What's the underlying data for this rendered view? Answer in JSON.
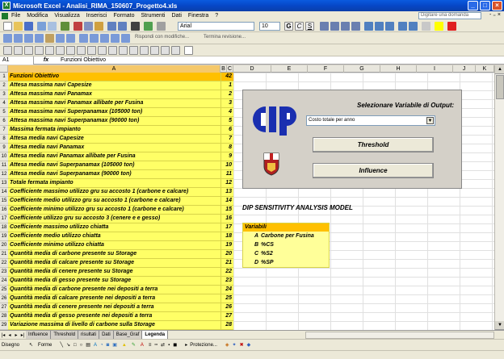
{
  "window": {
    "title": "Microsoft Excel - Analisi_RIMA_150607_Progetto4.xls"
  },
  "menu": {
    "items": [
      "File",
      "Modifica",
      "Visualizza",
      "Inserisci",
      "Formato",
      "Strumenti",
      "Dati",
      "Finestra",
      "?"
    ],
    "help_placeholder": "Digitare una domanda"
  },
  "toolbar": {
    "font_name": "Arial",
    "font_size": "10",
    "reply_text": "Rispondi con modifiche...",
    "end_review": "Termina revisione..."
  },
  "formula_bar": {
    "cell_ref": "A1",
    "fx": "fx",
    "content": "Funzioni Obiettivo"
  },
  "columns": [
    "A",
    "B",
    "C",
    "D",
    "E",
    "F",
    "G",
    "H",
    "I",
    "J",
    "K"
  ],
  "rows": [
    {
      "num": "1",
      "label": "Funzioni Obiettivo",
      "value": "42"
    },
    {
      "num": "2",
      "label": "Attesa massima navi Capesize",
      "value": "1"
    },
    {
      "num": "3",
      "label": "Attesa massima navi Panamax",
      "value": "2"
    },
    {
      "num": "4",
      "label": "Attesa massima navi Panamax allibate per Fusina",
      "value": "3"
    },
    {
      "num": "5",
      "label": "Attesa massima navi Superpanamax (105000 ton)",
      "value": "4"
    },
    {
      "num": "6",
      "label": "Attesa massima navi Superpanamax (90000 ton)",
      "value": "5"
    },
    {
      "num": "7",
      "label": "Massima fermata impianto",
      "value": "6"
    },
    {
      "num": "8",
      "label": "Attesa media navi Capesize",
      "value": "7"
    },
    {
      "num": "9",
      "label": "Attesa media navi Panamax",
      "value": "8"
    },
    {
      "num": "10",
      "label": "Attesa media navi Panamax allibate per Fusina",
      "value": "9"
    },
    {
      "num": "11",
      "label": "Attesa media navi Superpanamax (105000 ton)",
      "value": "10"
    },
    {
      "num": "12",
      "label": "Attesa media navi Superpanamax (90000 ton)",
      "value": "11"
    },
    {
      "num": "13",
      "label": "Totale fermata impianto",
      "value": "12"
    },
    {
      "num": "14",
      "label": "Coefficiente massimo utilizzo gru su accosto 1 (carbone e calcare)",
      "value": "13"
    },
    {
      "num": "15",
      "label": "Coefficiente medio utilizzo gru su accosto 1 (carbone e calcare)",
      "value": "14"
    },
    {
      "num": "16",
      "label": "Coefficiente minimo utilizzo gru su accosto 1 (carbone e calcare)",
      "value": "15"
    },
    {
      "num": "17",
      "label": "Coefficiente utilizzo gru su accosto 3 (cenere e e gesso)",
      "value": "16"
    },
    {
      "num": "18",
      "label": "Coefficiente massimo utilizzo chiatta",
      "value": "17"
    },
    {
      "num": "19",
      "label": "Coefficiente medio utilizzo chiatta",
      "value": "18"
    },
    {
      "num": "20",
      "label": "Coefficiente minimo utilizzo chiatta",
      "value": "19"
    },
    {
      "num": "21",
      "label": "Quantità media di carbone presente su Storage",
      "value": "20"
    },
    {
      "num": "22",
      "label": "Quantità media di calcare presente su Storage",
      "value": "21"
    },
    {
      "num": "23",
      "label": "Quantità media di cenere presente su Storage",
      "value": "22"
    },
    {
      "num": "24",
      "label": "Quantità media di gesso presente su Storage",
      "value": "23"
    },
    {
      "num": "25",
      "label": "Quantità media di carbone presente nei depositi a terra",
      "value": "24"
    },
    {
      "num": "26",
      "label": "Quantità media di calcare presente nei depositi a terra",
      "value": "25"
    },
    {
      "num": "27",
      "label": "Quantità media di cenere presente nei depositi a terra",
      "value": "26"
    },
    {
      "num": "28",
      "label": "Quantità media di gesso presente nei depositi a terra",
      "value": "27"
    },
    {
      "num": "29",
      "label": "Variazione massima di livello di carbone sulla Storage",
      "value": "28"
    }
  ],
  "panel": {
    "logo_text": "dip",
    "title": "Selezionare Variabile di Output:",
    "dropdown_value": "Costo totale per anno",
    "threshold_button": "Threshold",
    "influence_button": "Influence"
  },
  "model_title": "DIP SENSITIVITY ANALYSIS MODEL",
  "variables": {
    "header": "Variabili",
    "items": [
      {
        "letter": "A",
        "name": "Carbone per Fusina"
      },
      {
        "letter": "B",
        "name": "%CS"
      },
      {
        "letter": "C",
        "name": "%S2"
      },
      {
        "letter": "D",
        "name": "%SP"
      }
    ]
  },
  "sheet_tabs": [
    "Influence",
    "Threshold",
    "risultati",
    "Dati",
    "Base_Graf",
    "Legenda"
  ],
  "active_tab": "Legenda",
  "drawbar": {
    "draw_label": "Disegno",
    "shapes_label": "Forme",
    "protection_label": "Protezione..."
  },
  "colors": {
    "title_bar": "#0647c6",
    "cell_yellow": "#ffff66",
    "header_orange": "#ffc000",
    "logo_blue": "#1a2fb0"
  }
}
